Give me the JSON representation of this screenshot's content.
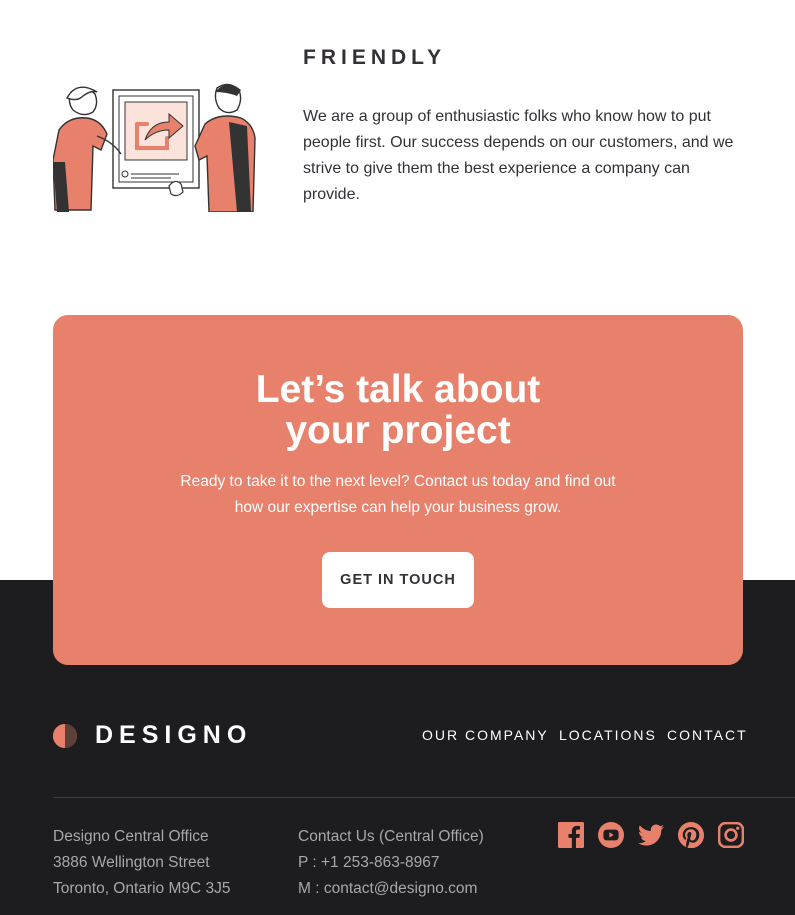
{
  "friendly": {
    "title": "FRIENDLY",
    "text": "We are a group of enthusiastic folks who know how to put people first. Our success depends on our customers, and we strive to give them the best experience a company can provide."
  },
  "cta": {
    "title_line1": "Let’s talk about",
    "title_line2": "your project",
    "text": "Ready to take it to the next level? Contact us today and find out how our expertise can help your business grow.",
    "button_label": "GET IN TOUCH"
  },
  "footer": {
    "logo_text": "DESIGNO",
    "nav": [
      "OUR COMPANY",
      "LOCATIONS",
      "CONTACT"
    ],
    "address": {
      "line1": "Designo Central Office",
      "line2": "3886 Wellington Street",
      "line3": "Toronto, Ontario M9C 3J5"
    },
    "contact": {
      "line1": "Contact Us (Central Office)",
      "line2": "P : +1 253-863-8967",
      "line3": "M : contact@designo.com"
    },
    "social_icons": [
      "facebook-icon",
      "youtube-icon",
      "twitter-icon",
      "pinterest-icon",
      "instagram-icon"
    ]
  },
  "colors": {
    "accent": "#e7816b",
    "dark": "#1d1c1e",
    "text": "#333136",
    "muted": "#a8a7ab"
  }
}
